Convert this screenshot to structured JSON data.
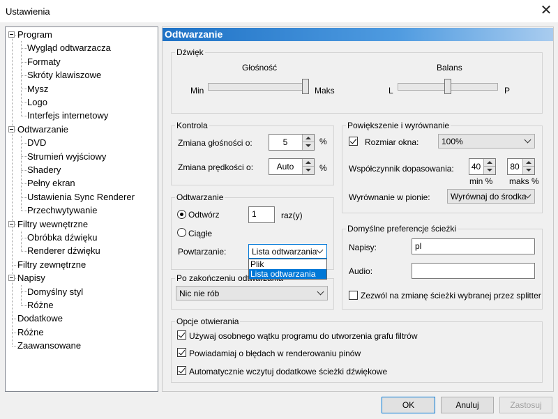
{
  "window": {
    "title": "Ustawienia"
  },
  "tree": [
    {
      "label": "Program",
      "level": 0,
      "expandable": true
    },
    {
      "label": "Wygląd odtwarzacza",
      "level": 1
    },
    {
      "label": "Formaty",
      "level": 1
    },
    {
      "label": "Skróty klawiszowe",
      "level": 1
    },
    {
      "label": "Mysz",
      "level": 1
    },
    {
      "label": "Logo",
      "level": 1
    },
    {
      "label": "Interfejs internetowy",
      "level": 1
    },
    {
      "label": "Odtwarzanie",
      "level": 0,
      "expandable": true,
      "selected": true
    },
    {
      "label": "DVD",
      "level": 1
    },
    {
      "label": "Strumień wyjściowy",
      "level": 1
    },
    {
      "label": "Shadery",
      "level": 1
    },
    {
      "label": "Pełny ekran",
      "level": 1
    },
    {
      "label": "Ustawienia Sync Renderer",
      "level": 1
    },
    {
      "label": "Przechwytywanie",
      "level": 1
    },
    {
      "label": "Filtry wewnętrzne",
      "level": 0,
      "expandable": true
    },
    {
      "label": "Obróbka dźwięku",
      "level": 1
    },
    {
      "label": "Renderer dźwięku",
      "level": 1
    },
    {
      "label": "Filtry zewnętrzne",
      "level": 0
    },
    {
      "label": "Napisy",
      "level": 0,
      "expandable": true
    },
    {
      "label": "Domyślny styl",
      "level": 1
    },
    {
      "label": "Różne",
      "level": 1
    },
    {
      "label": "Dodatkowe",
      "level": 0
    },
    {
      "label": "Różne",
      "level": 0
    },
    {
      "label": "Zaawansowane",
      "level": 0
    }
  ],
  "page": {
    "title": "Odtwarzanie",
    "sound": {
      "legend": "Dźwięk",
      "volume_label": "Głośność",
      "volume_min": "Min",
      "volume_max": "Maks",
      "volume_level": 1.0,
      "balance_label": "Balans",
      "balance_left": "L",
      "balance_right": "P",
      "balance_level": 0.5
    },
    "control": {
      "legend": "Kontrola",
      "volume_step_label": "Zmiana głośności o:",
      "volume_step_value": "5",
      "volume_step_unit": "%",
      "speed_step_label": "Zmiana prędkości o:",
      "speed_step_value": "Auto",
      "speed_step_unit": "%"
    },
    "playback": {
      "legend": "Odtwarzanie",
      "play_label": "Odtwórz",
      "play_count": "1",
      "play_unit": "raz(y)",
      "loop_label": "Ciągłe",
      "repeat_label": "Powtarzanie:",
      "repeat_value": "Lista odtwarzania",
      "repeat_options": [
        "Plik",
        "Lista odtwarzania"
      ]
    },
    "after": {
      "legend": "Po zakończeniu odtwarzania",
      "value": "Nic nie rób"
    },
    "zoom": {
      "legend": "Powiększenie i wyrównanie",
      "window_size_label": "Rozmiar okna:",
      "window_size_value": "100%",
      "fit_label": "Współczynnik dopasowania:",
      "fit_min_value": "40",
      "fit_max_value": "80",
      "fit_min_caption": "min %",
      "fit_max_caption": "maks %",
      "vertical_label": "Wyrównanie w pionie:",
      "vertical_value": "Wyrównaj do środka"
    },
    "tracks": {
      "legend": "Domyślne preferencje ścieżki",
      "subtitles_label": "Napisy:",
      "subtitles_value": "pl",
      "audio_label": "Audio:",
      "audio_value": "",
      "splitter_label": "Zezwól na zmianę ścieżki wybranej przez splitter"
    },
    "open": {
      "legend": "Opcje otwierania",
      "opt1": "Używaj osobnego wątku programu do utworzenia grafu filtrów",
      "opt2": "Powiadamiaj o błędach w renderowaniu pinów",
      "opt3": "Automatycznie wczytuj dodatkowe ścieżki dźwiękowe"
    }
  },
  "buttons": {
    "ok": "OK",
    "cancel": "Anuluj",
    "apply": "Zastosuj"
  }
}
